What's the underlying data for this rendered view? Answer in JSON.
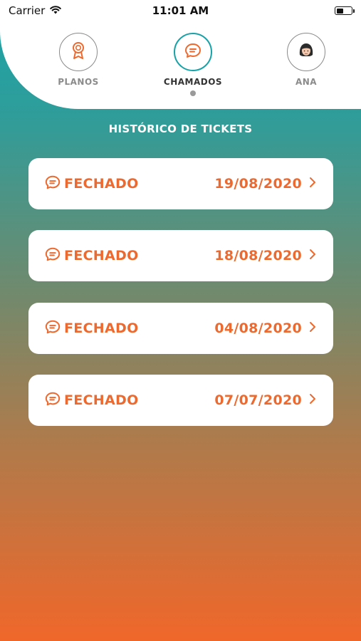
{
  "status_bar": {
    "carrier": "Carrier",
    "time": "11:01 AM",
    "battery_level": 0.45
  },
  "tabs": [
    {
      "label": "PLANOS",
      "icon": "award-ribbon-icon",
      "active": false
    },
    {
      "label": "CHAMADOS",
      "icon": "chat-bubble-icon",
      "active": true
    },
    {
      "label": "ANA",
      "icon": "avatar-ana-icon",
      "active": false
    }
  ],
  "section_title": "HISTÓRICO DE TICKETS",
  "tickets": [
    {
      "status": "FECHADO",
      "date": "19/08/2020"
    },
    {
      "status": "FECHADO",
      "date": "18/08/2020"
    },
    {
      "status": "FECHADO",
      "date": "04/08/2020"
    },
    {
      "status": "FECHADO",
      "date": "07/07/2020"
    }
  ],
  "colors": {
    "accent_teal": "#17a2a7",
    "accent_orange": "#ec6a2f",
    "gradient_top": "#1aa3a8",
    "gradient_bottom": "#f0672a"
  }
}
